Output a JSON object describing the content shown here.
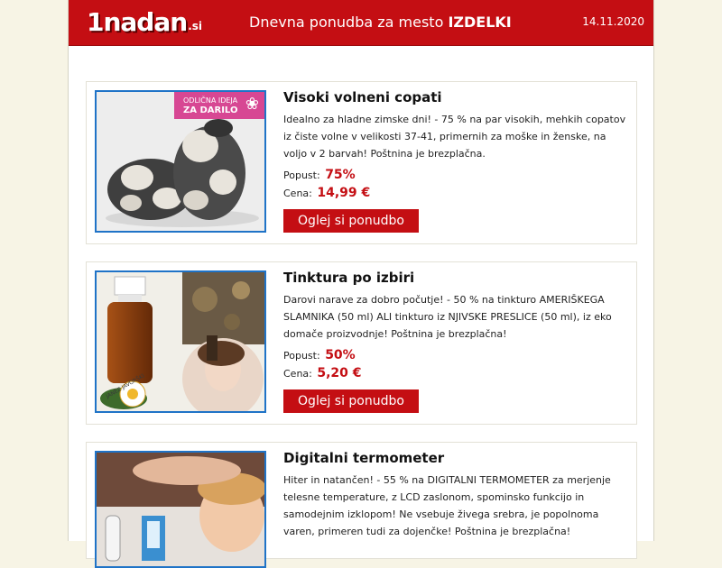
{
  "header": {
    "logo_main": "1nadan",
    "logo_tld": ".si",
    "title_prefix": "Dnevna ponudba za mesto ",
    "title_city": "IZDELKI",
    "date": "14.11.2020"
  },
  "offers": [
    {
      "title": "Visoki volneni copati",
      "description": "Idealno za hladne zimske dni! - 75 % na par visokih, mehkih copatov iz čiste volne v velikosti 37-41, primernih za moške in ženske, na voljo v 2 barvah! Poštnina je brezplačna.",
      "discount_label": "Popust:",
      "discount_value": "75%",
      "price_label": "Cena:",
      "price_value": "14,99 €",
      "button_label": "Oglej si ponudbo",
      "badge_line1": "ODLIČNA IDEJA",
      "badge_line2": "ZA DARILO"
    },
    {
      "title": "Tinktura po izbiri",
      "description": "Darovi narave za dobro počutje! - 50 % na tinkturo AMERIŠKEGA SLAMNIKA (50 ml) ALI tinkturo iz NJIVSKE PRESLICE (50 ml), iz eko domače proizvodnje! Poštnina je brezplačna!",
      "discount_label": "Popust:",
      "discount_value": "50%",
      "price_label": "Cena:",
      "price_value": "5,20 €",
      "button_label": "Oglej si ponudbo",
      "brand_text": "JANEZ JAVORŠKI"
    },
    {
      "title": "Digitalni termometer",
      "description": "Hiter in natančen! - 55 % na DIGITALNI TERMOMETER za merjenje telesne temperature, z LCD zaslonom, spominsko funkcijo in samodejnim izklopom! Ne vsebuje živega srebra, je popolnoma varen, primeren tudi za dojenčke! Poštnina je brezplačna!"
    }
  ],
  "colors": {
    "brand_red": "#c40e13",
    "image_border": "#1f73c7",
    "page_bg": "#f7f4e5"
  }
}
